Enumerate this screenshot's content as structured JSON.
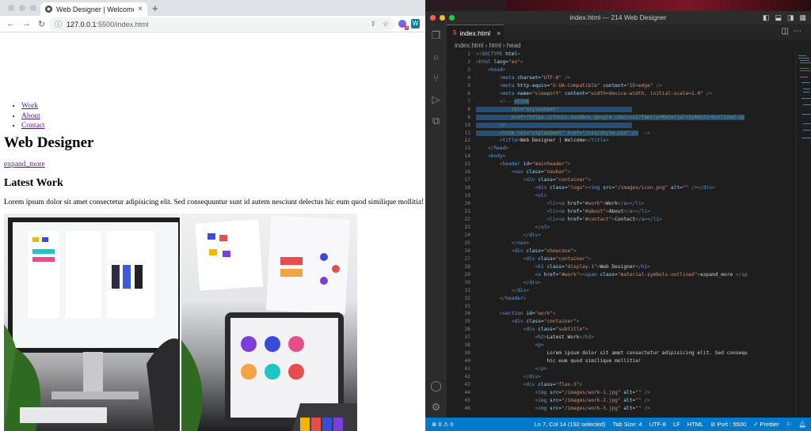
{
  "browser": {
    "tab_title": "Web Designer | Welcome",
    "tab_favicon": "globe-icon",
    "new_tab_label": "+",
    "url_host": "127.0.0.1",
    "url_rest": ":5500/index.html",
    "ext_badge": "2",
    "ext_w": "W"
  },
  "page": {
    "nav": [
      "Work",
      "About",
      "Contact"
    ],
    "title": "Web Designer",
    "expand": "expand_more",
    "section_title": "Latest Work",
    "lorem": "Lorem ipsum dolor sit amet consectetur adipisicing elit. Sed consequuntur sunt id autem nesciunt delectus hic eum quod similique mollitia!"
  },
  "vscode": {
    "window_title": "index.html — 214 Web Designer",
    "tab_label": "index.html",
    "tab_badge": "5",
    "breadcrumb": "index.html  ›  html  ›  head",
    "status_left": "⊗ 0  ⚠ 0",
    "status_items": [
      "Ln 7, Col 14 (192 selected)",
      "Tab Size: 4",
      "UTF-8",
      "LF",
      "HTML",
      "⊘ Port : 5500",
      "✓ Prettier"
    ],
    "line_numbers": "1\n2\n3\n4\n5\n6\n7\n8\n9\n10\n11\n12\n13\n14\n15\n16\n17\n18\n19\n20\n21\n22\n23\n24\n25\n26\n27\n28\n29\n30\n31\n32\n33\n34\n35\n36\n37\n38\n39\n40\n41\n42\n43\n44\n45\n46"
  },
  "colors": {
    "accent": "#007acc",
    "link": "#551a8b",
    "editor_bg": "#1e1e1e"
  }
}
